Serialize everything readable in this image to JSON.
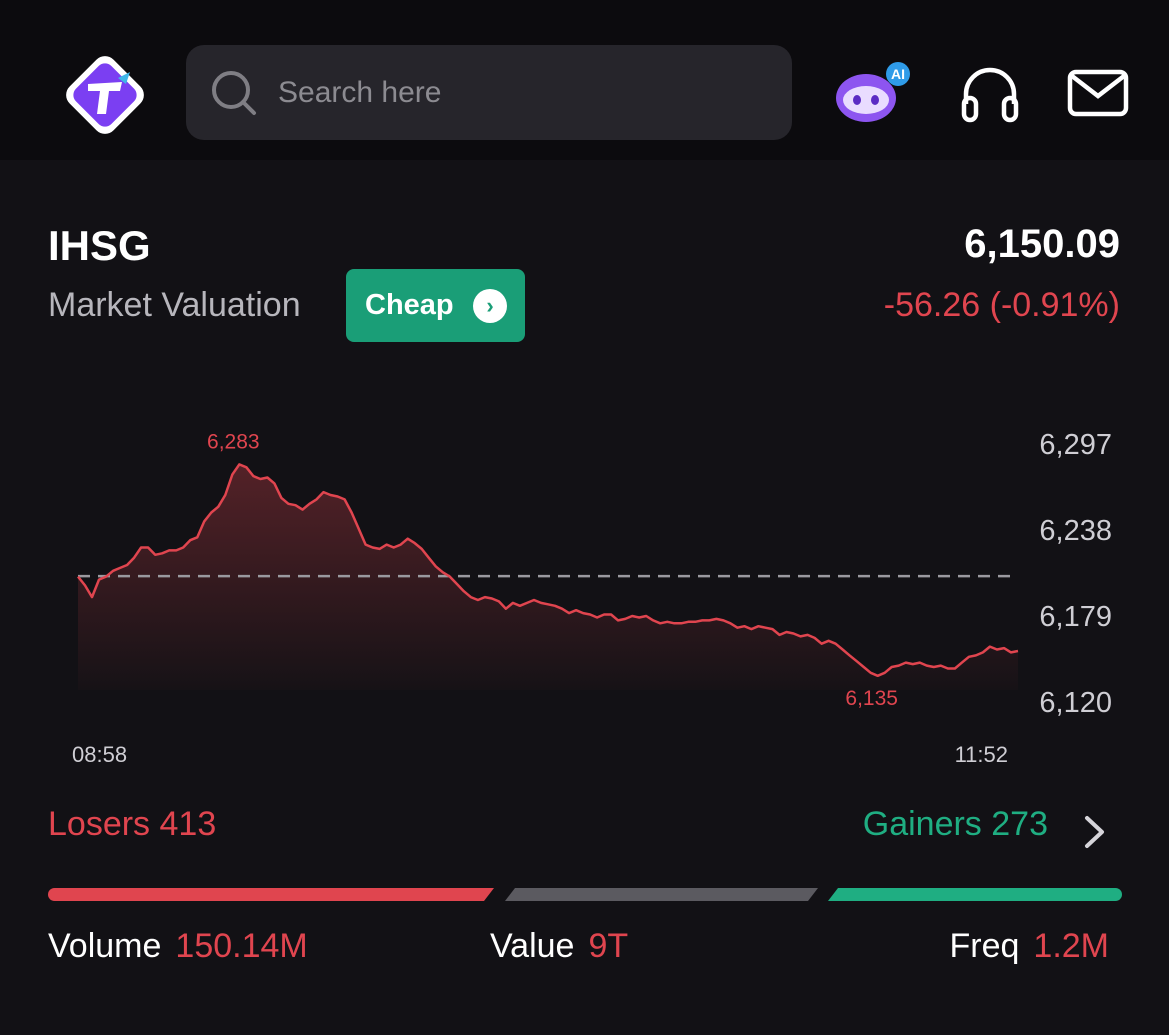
{
  "search": {
    "placeholder": "Search here"
  },
  "header": {
    "ai_badge": "AI"
  },
  "index": {
    "name": "IHSG",
    "valuation_label": "Market Valuation",
    "valuation_value": "Cheap",
    "price": "6,150.09",
    "change": "-56.26 (-0.91%)"
  },
  "colors": {
    "down": "#e0454f",
    "up": "#1fae82",
    "accent": "#1a9e77",
    "brand": "#7b3ff2"
  },
  "chart_data": {
    "type": "line",
    "x_start_label": "08:58",
    "x_end_label": "11:52",
    "y_ticks": [
      "6,297",
      "6,238",
      "6,179",
      "6,120"
    ],
    "ylim": [
      6120,
      6297
    ],
    "reference_line": 6206.35,
    "high_label": "6,283",
    "low_label": "6,135",
    "values": [
      6206,
      6200,
      6192,
      6204,
      6206,
      6210,
      6212,
      6214,
      6219,
      6226,
      6226,
      6221,
      6222,
      6224,
      6224,
      6226,
      6231,
      6233,
      6244,
      6250,
      6254,
      6262,
      6276,
      6283,
      6281,
      6275,
      6273,
      6274,
      6270,
      6260,
      6256,
      6255,
      6252,
      6256,
      6259,
      6264,
      6262,
      6261,
      6259,
      6250,
      6239,
      6228,
      6226,
      6225,
      6228,
      6226,
      6228,
      6232,
      6229,
      6225,
      6219,
      6213,
      6209,
      6206,
      6201,
      6196,
      6192,
      6190,
      6192,
      6191,
      6189,
      6184,
      6188,
      6186,
      6188,
      6190,
      6188,
      6187,
      6186,
      6184,
      6181,
      6183,
      6181,
      6180,
      6178,
      6180,
      6180,
      6176,
      6177,
      6179,
      6178,
      6179,
      6176,
      6174,
      6175,
      6174,
      6174,
      6175,
      6175,
      6176,
      6176,
      6177,
      6176,
      6174,
      6171,
      6172,
      6170,
      6172,
      6171,
      6170,
      6166,
      6168,
      6167,
      6165,
      6166,
      6164,
      6160,
      6162,
      6160,
      6156,
      6152,
      6148,
      6144,
      6140,
      6138,
      6140,
      6144,
      6145,
      6147,
      6146,
      6147,
      6145,
      6144,
      6145,
      6143,
      6143,
      6147,
      6151,
      6152,
      6154,
      6158,
      6156,
      6157,
      6154,
      6155
    ]
  },
  "breadth": {
    "losers_label": "Losers",
    "losers_count": "413",
    "gainers_label": "Gainers",
    "gainers_count": "273",
    "losers_share": 0.397,
    "neutral_share": 0.317,
    "gainers_share": 0.286
  },
  "stats": {
    "volume_label": "Volume",
    "volume_value": "150.14M",
    "value_label": "Value",
    "value_value": "9T",
    "freq_label": "Freq",
    "freq_value": "1.2M"
  }
}
